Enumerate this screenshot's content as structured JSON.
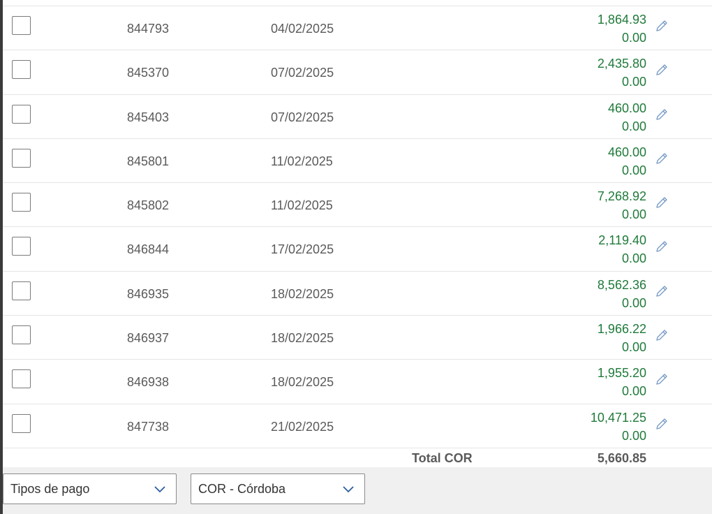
{
  "rows": [
    {
      "doc": "844793",
      "date": "04/02/2025",
      "amount": "1,864.93",
      "amount2": "0.00"
    },
    {
      "doc": "845370",
      "date": "07/02/2025",
      "amount": "2,435.80",
      "amount2": "0.00"
    },
    {
      "doc": "845403",
      "date": "07/02/2025",
      "amount": "460.00",
      "amount2": "0.00"
    },
    {
      "doc": "845801",
      "date": "11/02/2025",
      "amount": "460.00",
      "amount2": "0.00"
    },
    {
      "doc": "845802",
      "date": "11/02/2025",
      "amount": "7,268.92",
      "amount2": "0.00"
    },
    {
      "doc": "846844",
      "date": "17/02/2025",
      "amount": "2,119.40",
      "amount2": "0.00"
    },
    {
      "doc": "846935",
      "date": "18/02/2025",
      "amount": "8,562.36",
      "amount2": "0.00"
    },
    {
      "doc": "846937",
      "date": "18/02/2025",
      "amount": "1,966.22",
      "amount2": "0.00"
    },
    {
      "doc": "846938",
      "date": "18/02/2025",
      "amount": "1,955.20",
      "amount2": "0.00"
    },
    {
      "doc": "847738",
      "date": "21/02/2025",
      "amount": "10,471.25",
      "amount2": "0.00"
    }
  ],
  "total": {
    "label": "Total COR",
    "value": "5,660.85"
  },
  "footer": {
    "payment_type_select": {
      "value": "Tipos de pago",
      "icon": "chevron-down-icon"
    },
    "currency_select": {
      "value": "COR - Córdoba",
      "icon": "chevron-down-icon"
    }
  },
  "colors": {
    "amount": "#1f7a3a",
    "edit_icon": "#7a9cc6",
    "footer_bg": "#f0f0f0"
  }
}
